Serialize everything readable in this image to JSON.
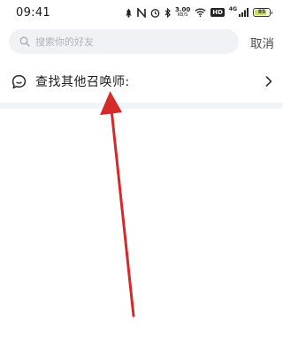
{
  "status_bar": {
    "time": "09:41",
    "net_speed_value": "3.00",
    "net_speed_unit": "KB/S",
    "hd_label": "HD",
    "signal_label": "4G",
    "battery_percent": "85",
    "battery_level": 0.85,
    "icons": [
      "mute-icon",
      "nfc-icon",
      "alarm-icon",
      "bluetooth-icon",
      "wifi-icon",
      "signal-icon",
      "battery-icon"
    ]
  },
  "search": {
    "placeholder": "搜索你的好友",
    "value": "",
    "cancel_label": "取消"
  },
  "find_row": {
    "label": "查找其他召唤师:"
  },
  "colors": {
    "search_bg": "#f1f2f5",
    "divider": "#f3f4f6",
    "arrow": "#d42a2a",
    "battery_fill": "#c8e05a"
  }
}
